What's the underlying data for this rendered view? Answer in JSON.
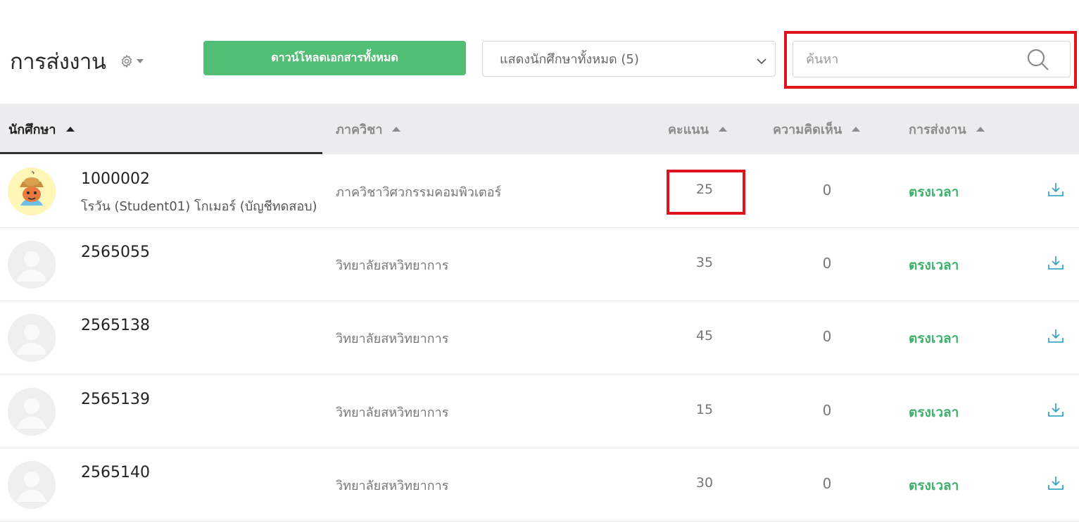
{
  "header": {
    "title": "การส่งงาน",
    "download_all_label": "ดาวน์โหลดเอกสารทั้งหมด",
    "filter_value": "แสดงนักศึกษาทั้งหมด (5)",
    "search_placeholder": "ค้นหา"
  },
  "table": {
    "columns": {
      "student": "นักศึกษา",
      "department": "ภาควิชา",
      "score": "คะแนน",
      "comments": "ความคิดเห็น",
      "submission": "การส่งงาน"
    },
    "rows": [
      {
        "id": "1000002",
        "name": "โรวัน (Student01) โกเมอร์ (บัญชีทดสอบ)",
        "department": "ภาควิชาวิศวกรรมคอมพิวเตอร์",
        "score": "25",
        "comments": "0",
        "status": "ตรงเวลา"
      },
      {
        "id": "2565055",
        "name": "",
        "department": "วิทยาลัยสหวิทยาการ",
        "score": "35",
        "comments": "0",
        "status": "ตรงเวลา"
      },
      {
        "id": "2565138",
        "name": "",
        "department": "วิทยาลัยสหวิทยาการ",
        "score": "45",
        "comments": "0",
        "status": "ตรงเวลา"
      },
      {
        "id": "2565139",
        "name": "",
        "department": "วิทยาลัยสหวิทยาการ",
        "score": "15",
        "comments": "0",
        "status": "ตรงเวลา"
      },
      {
        "id": "2565140",
        "name": "",
        "department": "วิทยาลัยสหวิทยาการ",
        "score": "30",
        "comments": "0",
        "status": "ตรงเวลา"
      }
    ]
  },
  "colors": {
    "accent_green": "#52bd74",
    "status_green": "#3fb06a",
    "download_icon": "#3aa7c9",
    "highlight_red": "#e0121c"
  },
  "icons": [
    "gear-icon",
    "caret-down-icon",
    "chevron-down-icon",
    "search-icon",
    "sort-asc-icon",
    "download-icon"
  ]
}
